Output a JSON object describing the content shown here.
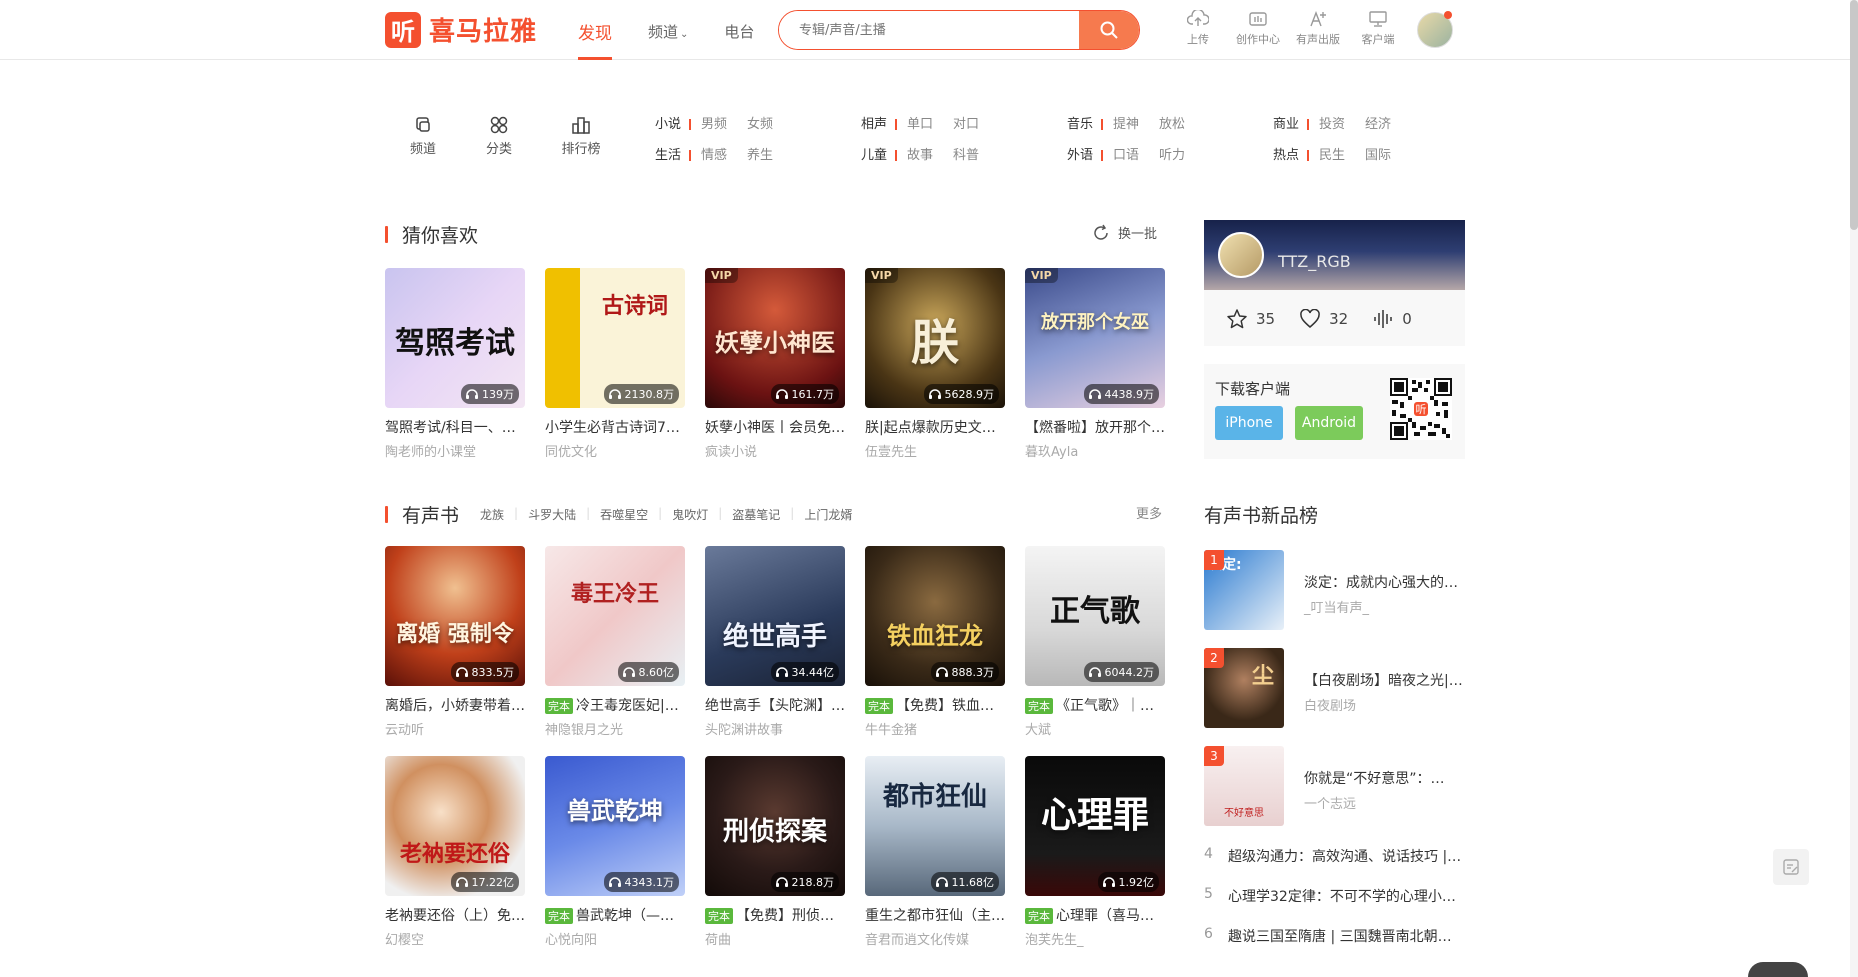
{
  "header": {
    "logo_mark": "听",
    "logo_text": "喜马拉雅",
    "nav": [
      "发现",
      "频道",
      "电台"
    ],
    "search_placeholder": "专辑/声音/主播",
    "tools": [
      "上传",
      "创作中心",
      "有声出版",
      "客户端"
    ]
  },
  "categories": {
    "icons": [
      "频道",
      "分类",
      "排行榜"
    ],
    "groups": [
      {
        "title": "小说",
        "subs": [
          "男频",
          "女频"
        ]
      },
      {
        "title": "生活",
        "subs": [
          "情感",
          "养生"
        ]
      },
      {
        "title": "相声",
        "subs": [
          "单口",
          "对口"
        ]
      },
      {
        "title": "儿童",
        "subs": [
          "故事",
          "科普"
        ]
      },
      {
        "title": "音乐",
        "subs": [
          "提神",
          "放松"
        ]
      },
      {
        "title": "外语",
        "subs": [
          "口语",
          "听力"
        ]
      },
      {
        "title": "商业",
        "subs": [
          "投资",
          "经济"
        ]
      },
      {
        "title": "热点",
        "subs": [
          "民生",
          "国际"
        ]
      }
    ]
  },
  "guess": {
    "title": "猜你喜欢",
    "refresh": "换一批",
    "items": [
      {
        "cover_text": "驾照考试",
        "plays": "139万",
        "name": "驾照考试/科目一、…",
        "author": "陶老师的小课堂",
        "vip": ""
      },
      {
        "cover_text": "古诗词",
        "plays": "2130.8万",
        "name": "小学生必背古诗词7…",
        "author": "同优文化",
        "vip": ""
      },
      {
        "cover_text": "妖孽小神医",
        "plays": "161.7万",
        "name": "妖孽小神医丨会员免…",
        "author": "疯读小说",
        "vip": "VIP"
      },
      {
        "cover_text": "朕",
        "plays": "5628.9万",
        "name": "朕|起点爆款历史文…",
        "author": "伍壹先生",
        "vip": "VIP"
      },
      {
        "cover_text": "放开那个女巫",
        "plays": "4438.9万",
        "name": "【燃番啦】放开那个…",
        "author": "暮玖Ayla",
        "vip": "VIP"
      }
    ]
  },
  "audiobook": {
    "title": "有声书",
    "tags": [
      "龙族",
      "斗罗大陆",
      "吞噬星空",
      "鬼吹灯",
      "盗墓笔记",
      "上门龙婿"
    ],
    "more": "更多",
    "items": [
      {
        "cover_text": "离婚 强制令",
        "plays": "833.5万",
        "badge": "",
        "name": "离婚后，小娇妻带着…",
        "author": "云动听"
      },
      {
        "cover_text": "毒王冷王",
        "plays": "8.60亿",
        "badge": "完本",
        "name": "冷王毒宠医妃|…",
        "author": "神隐银月之光"
      },
      {
        "cover_text": "绝世高手",
        "plays": "34.44亿",
        "badge": "",
        "name": "绝世高手【头陀渊】…",
        "author": "头陀渊讲故事"
      },
      {
        "cover_text": "铁血狂龙",
        "plays": "888.3万",
        "badge": "完本",
        "name": "【免费】铁血…",
        "author": "牛牛金猪"
      },
      {
        "cover_text": "正气歌",
        "plays": "6044.2万",
        "badge": "完本",
        "name": "《正气歌》｜…",
        "author": "大斌"
      },
      {
        "cover_text": "老衲要还俗",
        "plays": "17.22亿",
        "badge": "",
        "name": "老衲要还俗（上）免…",
        "author": "幻樱空"
      },
      {
        "cover_text": "兽武乾坤",
        "plays": "4343.1万",
        "badge": "完本",
        "name": "兽武乾坤（—…",
        "author": "心悦向阳"
      },
      {
        "cover_text": "刑侦探案",
        "plays": "218.8万",
        "badge": "完本",
        "name": "【免费】刑侦…",
        "author": "荷曲"
      },
      {
        "cover_text": "都市狂仙",
        "plays": "11.68亿",
        "badge": "",
        "name": "重生之都市狂仙（主…",
        "author": "音君而逍文化传媒"
      },
      {
        "cover_text": "心理罪",
        "plays": "1.92亿",
        "badge": "完本",
        "name": "心理罪（喜马…",
        "author": "泡芙先生_"
      }
    ]
  },
  "profile": {
    "username": "TTZ_RGB",
    "stars": "35",
    "likes": "32",
    "tracks": "0"
  },
  "download": {
    "label": "下载客户端",
    "ios": "iPhone",
    "android": "Android",
    "qr_mark": "听"
  },
  "ranking": {
    "title": "有声书新品榜",
    "top": [
      {
        "num": "1",
        "cover_text": "淡定:",
        "name": "淡定：成就内心强大的…",
        "author": "_叮当有声_"
      },
      {
        "num": "2",
        "cover_text": "尘",
        "name": "【白夜剧场】暗夜之光|…",
        "author": "白夜剧场"
      },
      {
        "num": "3",
        "cover_text": "不好意思",
        "name": "你就是“不好意思”：…",
        "author": "一个志远"
      }
    ],
    "list": [
      {
        "num": "4",
        "name": "超级沟通力：高效沟通、说话技巧 |…"
      },
      {
        "num": "5",
        "name": "心理学32定律：不可不学的心理小…"
      },
      {
        "num": "6",
        "name": "趣说三国至隋唐 | 三国魏晋南北朝…"
      }
    ]
  },
  "colors": {
    "accent": "#f4502f",
    "complete_badge": "#5ab83c"
  }
}
